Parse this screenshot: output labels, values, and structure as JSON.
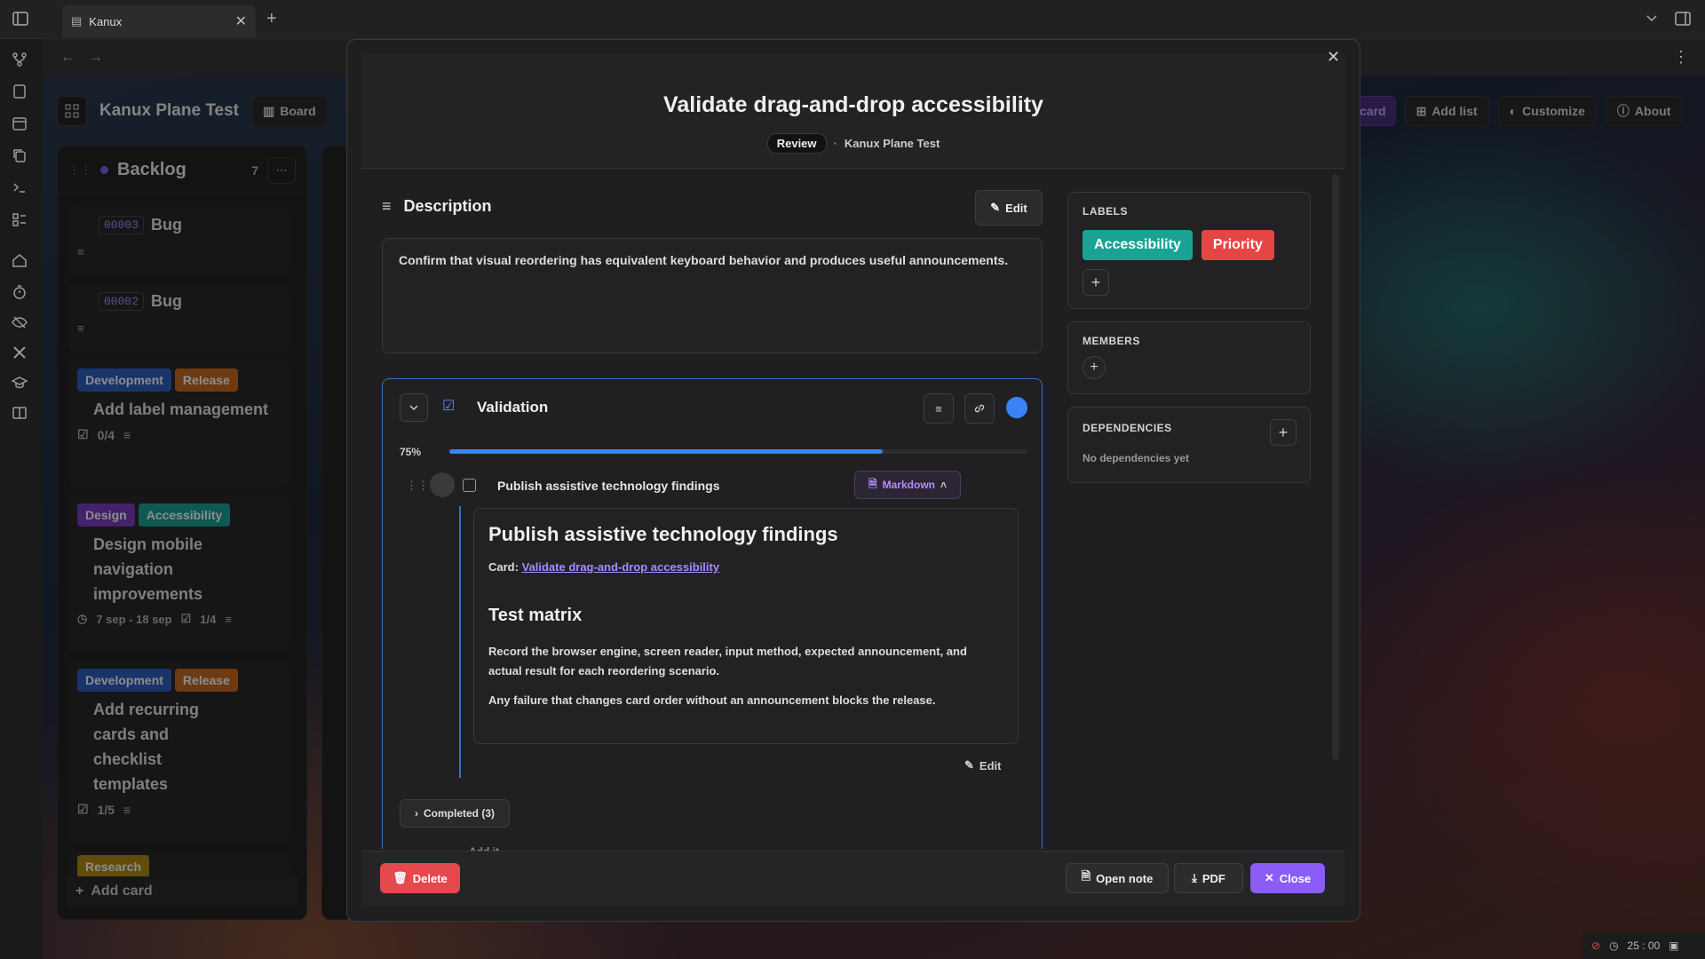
{
  "browser": {
    "tab_title": "Kanux",
    "new_tab": "+"
  },
  "board": {
    "title": "Kanux Plane Test",
    "view_button": "Board",
    "add_card_partial": "card",
    "add_list": "Add list",
    "customize": "Customize",
    "about": "About"
  },
  "backlog": {
    "name": "Backlog",
    "count": "7",
    "cards": [
      {
        "id": "00003",
        "title": "Bug"
      },
      {
        "id": "00002",
        "title": "Bug"
      },
      {
        "labels": [
          "Development",
          "Release"
        ],
        "title": "Add label management",
        "checklist": "0/4"
      },
      {
        "labels": [
          "Design",
          "Accessibility"
        ],
        "title": "Design mobile navigation improvements",
        "dates": "7 sep - 18 sep",
        "checklist": "1/4"
      },
      {
        "labels": [
          "Development",
          "Release"
        ],
        "title": "Add recurring cards and checklist templates",
        "checklist": "1/5"
      },
      {
        "labels": [
          "Research"
        ]
      }
    ],
    "add_card": "Add card"
  },
  "colors": {
    "Development": "#2f5fbf",
    "Release": "#c96a20",
    "Design": "#7a3fbf",
    "Accessibility": "#1aa394",
    "Research": "#b38a12",
    "Priority": "#e64545",
    "accent": "#8b5cf6",
    "progress": "#3b82f6",
    "delete": "#e5484d"
  },
  "modal": {
    "title": "Validate drag-and-drop accessibility",
    "status_badge": "Review",
    "board_ref": "Kanux Plane Test",
    "description_heading": "Description",
    "edit_label": "Edit",
    "description_text": "Confirm that visual reordering has equivalent keyboard behavior and produces useful announcements.",
    "checklist": {
      "title": "Validation",
      "progress_text": "75%",
      "progress_value": 0.75,
      "item_text": "Publish assistive technology findings",
      "markdown_label": "Markdown",
      "note_heading": "Publish assistive technology findings",
      "card_prefix": "Card:",
      "card_link": "Validate drag-and-drop accessibility",
      "matrix_heading": "Test matrix",
      "matrix_p1": "Record the browser engine, screen reader, input method, expected announcement, and actual result for each reordering scenario.",
      "matrix_p2": "Any failure that changes card order without an announcement blocks the release.",
      "note_edit": "Edit",
      "completed": "Completed (3)",
      "add_item_partial": "Add it"
    },
    "labels_heading": "LABELS",
    "labels": [
      "Accessibility",
      "Priority"
    ],
    "members_heading": "MEMBERS",
    "dependencies_heading": "DEPENDENCIES",
    "dependencies_empty": "No dependencies yet",
    "footer": {
      "delete": "Delete",
      "open_note": "Open note",
      "pdf": "PDF",
      "close": "Close"
    }
  },
  "statusbar": {
    "timer": "25 : 00"
  }
}
